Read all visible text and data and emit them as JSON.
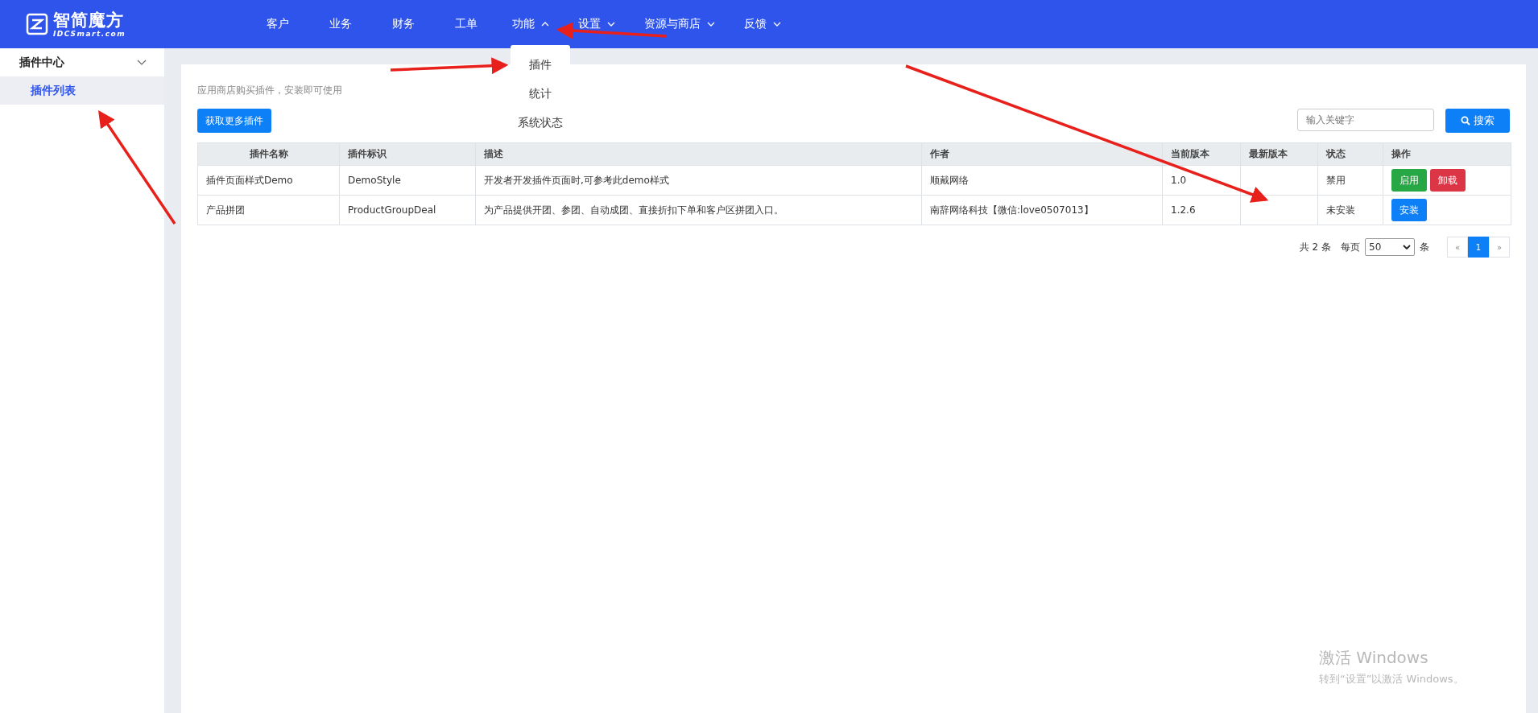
{
  "logo": {
    "name": "智简魔方",
    "sub": "IDCSmart.com"
  },
  "nav": [
    {
      "label": "客户"
    },
    {
      "label": "业务"
    },
    {
      "label": "财务"
    },
    {
      "label": "工单"
    },
    {
      "label": "功能",
      "expanded": true,
      "menu": [
        "插件",
        "统计",
        "系统状态"
      ]
    },
    {
      "label": "设置",
      "expanded": false
    },
    {
      "label": "资源与商店",
      "expanded": false
    },
    {
      "label": "反馈",
      "expanded": false
    }
  ],
  "sidebar": {
    "group": {
      "label": "插件中心",
      "expanded": true,
      "children": [
        {
          "label": "插件列表",
          "selected": true
        }
      ]
    }
  },
  "hint": "应用商店购买插件，安装即可使用",
  "more_button": "获取更多插件",
  "search": {
    "placeholder": "输入关键字",
    "button": "搜索"
  },
  "table": {
    "columns": [
      "插件名称",
      "插件标识",
      "描述",
      "作者",
      "当前版本",
      "最新版本",
      "状态",
      "操作"
    ],
    "rows": [
      {
        "cells": [
          "插件页面样式Demo",
          "DemoStyle",
          "开发者开发插件页面时,可参考此demo样式",
          "顺戴网络",
          "1.0",
          "",
          "禁用"
        ],
        "actions": [
          {
            "label": "启用",
            "kind": "success"
          },
          {
            "label": "卸载",
            "kind": "danger"
          }
        ]
      },
      {
        "cells": [
          "产品拼团",
          "ProductGroupDeal",
          "为产品提供开团、参团、自动成团、直接折扣下单和客户区拼团入口。",
          "南辞网络科技【微信:love0507013】",
          "1.2.6",
          "",
          "未安装"
        ],
        "actions": [
          {
            "label": "安装",
            "kind": "primary"
          }
        ]
      }
    ]
  },
  "pagination": {
    "total": "共 2 条",
    "per_page_label": "每页",
    "per_page": "50",
    "unit": "条",
    "prev": "«",
    "pages": [
      {
        "label": "1",
        "selected": true
      }
    ],
    "next": "»"
  },
  "activation_notice": {
    "title": "激活 Windows",
    "subtitle": "转到“设置”以激活 Windows。"
  }
}
